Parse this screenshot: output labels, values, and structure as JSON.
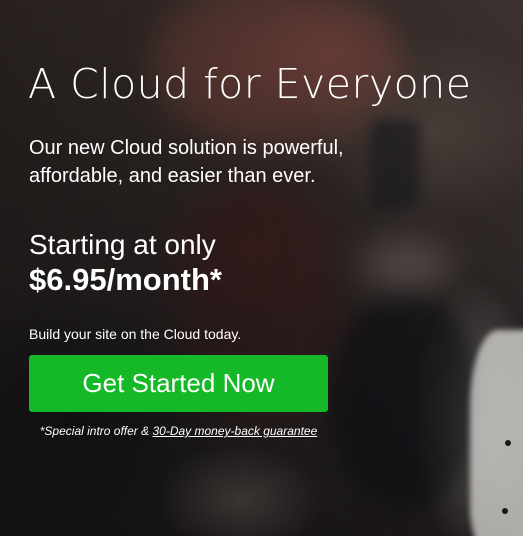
{
  "hero": {
    "headline": "A Cloud for Everyone",
    "subtitle_line1": "Our new Cloud solution is powerful,",
    "subtitle_line2": "affordable, and easier than ever.",
    "price_intro": "Starting at only",
    "price": "$6.95/month*",
    "cta_label": "Build your site on the Cloud today.",
    "cta_button": "Get Started Now",
    "offer_prefix": "*Special intro offer & ",
    "offer_link": "30-Day money-back guarantee"
  },
  "colors": {
    "cta_green": "#15b826",
    "text": "#ffffff"
  }
}
